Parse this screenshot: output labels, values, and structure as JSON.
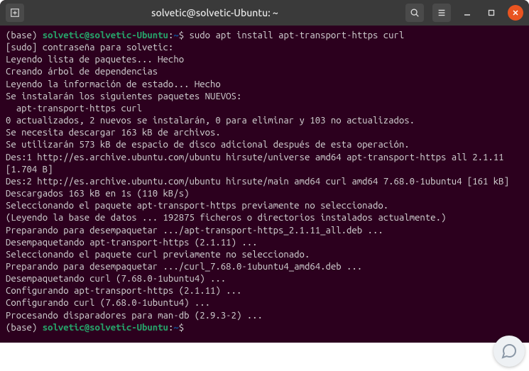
{
  "titlebar": {
    "title": "solvetic@solvetic-Ubuntu: ~"
  },
  "prompt1": {
    "base": "(base) ",
    "user": "solvetic@solvetic-Ubuntu",
    "colon": ":",
    "path": "~",
    "dollar": "$ ",
    "cmd": "sudo apt install apt-transport-https curl"
  },
  "lines": {
    "l1": "[sudo] contraseña para solvetic:",
    "l2": "Leyendo lista de paquetes... Hecho",
    "l3": "Creando árbol de dependencias",
    "l4": "Leyendo la información de estado... Hecho",
    "l5": "Se instalarán los siguientes paquetes NUEVOS:",
    "l6": "  apt-transport-https curl",
    "l7": "0 actualizados, 2 nuevos se instalarán, 0 para eliminar y 103 no actualizados.",
    "l8": "Se necesita descargar 163 kB de archivos.",
    "l9": "Se utilizarán 573 kB de espacio de disco adicional después de esta operación.",
    "l10": "Des:1 http://es.archive.ubuntu.com/ubuntu hirsute/universe amd64 apt-transport-https all 2.1.11 [1.704 B]",
    "l11": "Des:2 http://es.archive.ubuntu.com/ubuntu hirsute/main amd64 curl amd64 7.68.0-1ubuntu4 [161 kB]",
    "l12": "Descargados 163 kB en 1s (110 kB/s)",
    "l13": "Seleccionando el paquete apt-transport-https previamente no seleccionado.",
    "l14": "(Leyendo la base de datos ... 192875 ficheros o directorios instalados actualmente.)",
    "l15": "Preparando para desempaquetar .../apt-transport-https_2.1.11_all.deb ...",
    "l16": "Desempaquetando apt-transport-https (2.1.11) ...",
    "l17": "Seleccionando el paquete curl previamente no seleccionado.",
    "l18": "Preparando para desempaquetar .../curl_7.68.0-1ubuntu4_amd64.deb ...",
    "l19": "Desempaquetando curl (7.68.0-1ubuntu4) ...",
    "l20": "Configurando apt-transport-https (2.1.11) ...",
    "l21": "Configurando curl (7.68.0-1ubuntu4) ...",
    "l22": "Procesando disparadores para man-db (2.9.3-2) ..."
  },
  "prompt2": {
    "base": "(base) ",
    "user": "solvetic@solvetic-Ubuntu",
    "colon": ":",
    "path": "~",
    "dollar": "$"
  }
}
